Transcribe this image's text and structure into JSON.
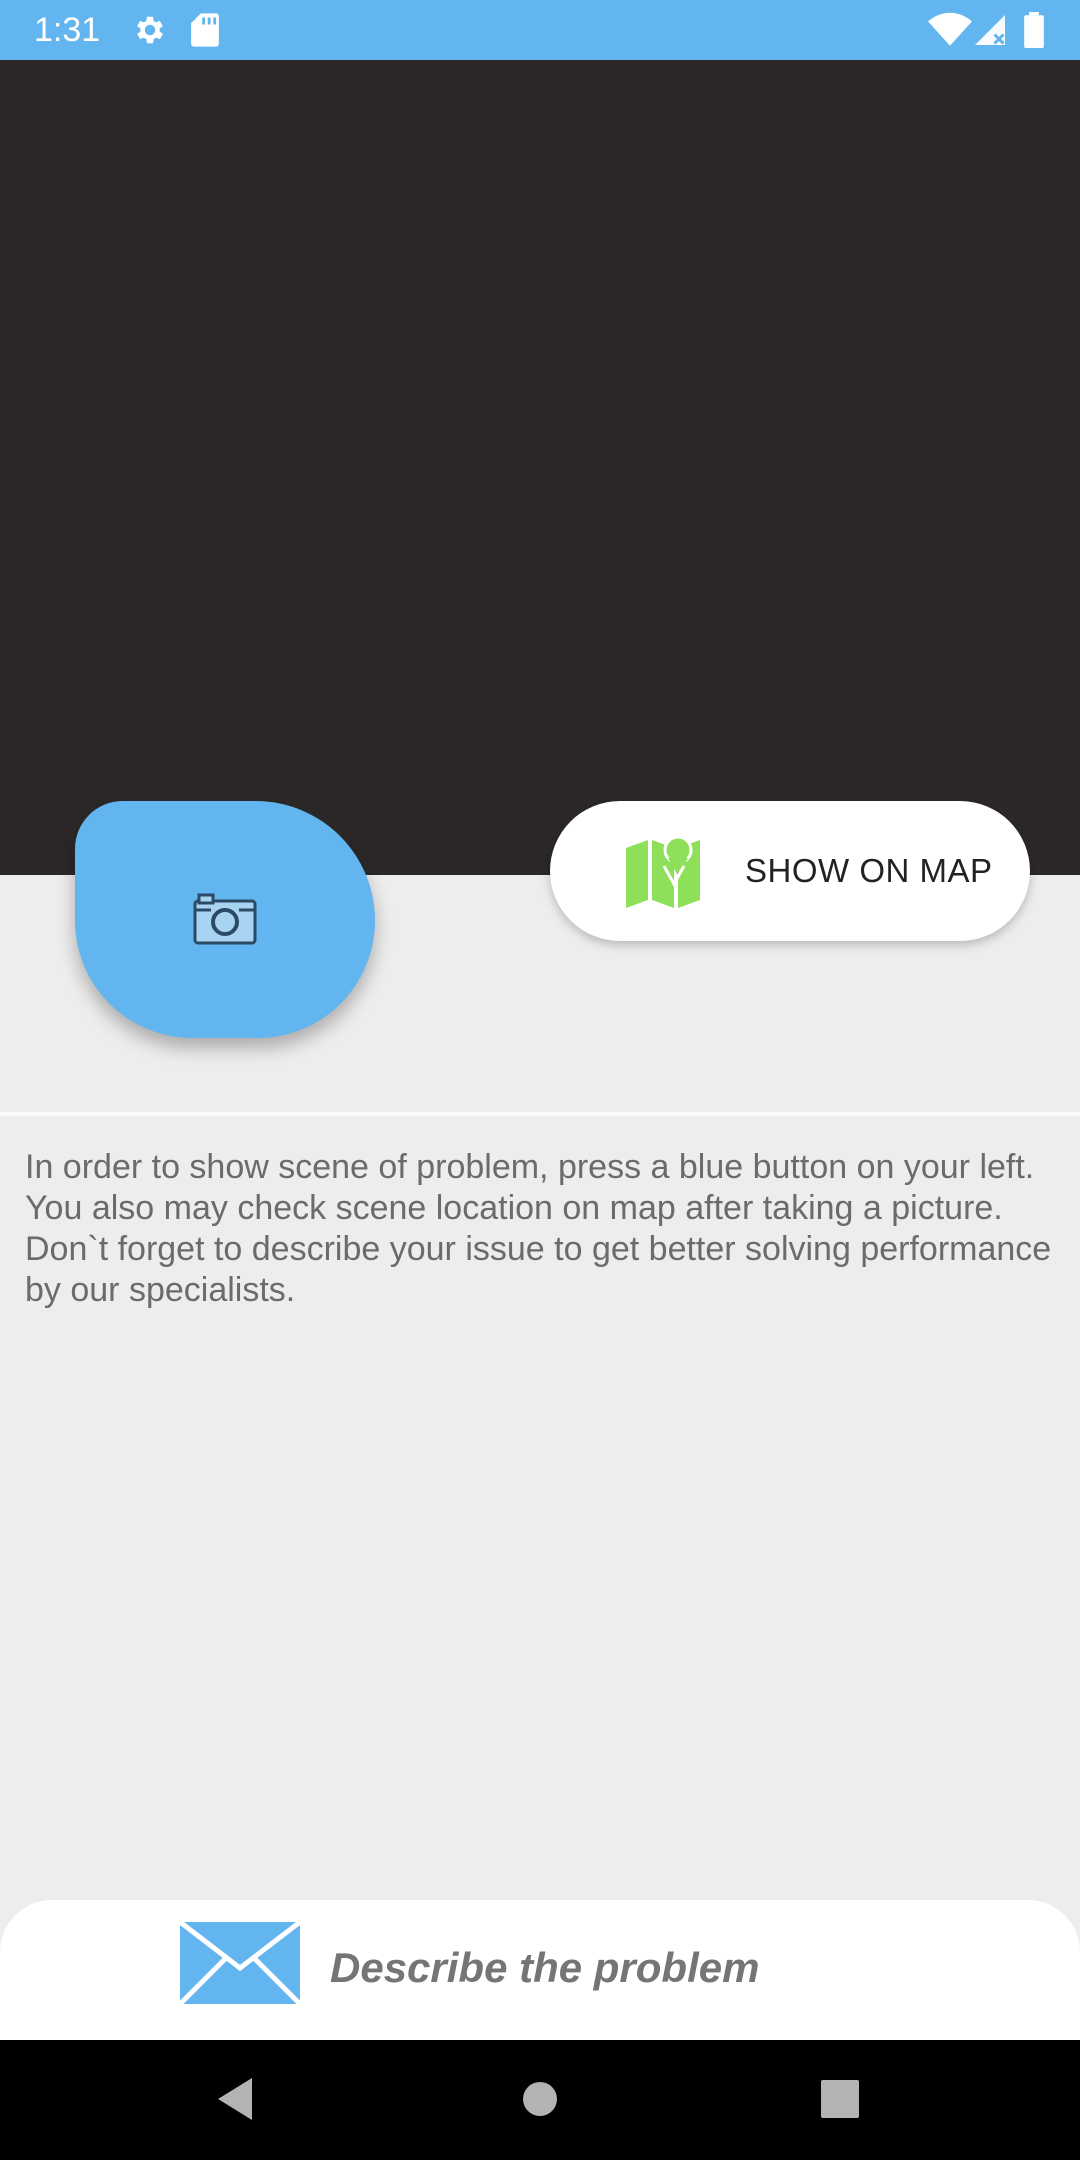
{
  "status_bar": {
    "time": "1:31",
    "left_icons": [
      "gear-icon",
      "sd-card-icon"
    ],
    "right_icons": [
      "wifi-icon",
      "signal-icon",
      "battery-icon"
    ]
  },
  "camera_button": {
    "icon": "camera-icon"
  },
  "map_button": {
    "label": "SHOW ON MAP",
    "icon": "map-icon"
  },
  "instructions": {
    "text": "In order to show scene of problem, press a blue button on your left. You also may check scene location on map after taking a picture.\n Don`t forget to describe your issue to get better solving performance by our specialists."
  },
  "describe_bar": {
    "label": "Describe the problem",
    "icon": "envelope-icon"
  },
  "nav_bar": {
    "buttons": [
      "back-icon",
      "home-icon",
      "recents-icon"
    ]
  },
  "colors": {
    "accent": "#62b5ee",
    "preview_bg": "#2c2828",
    "page_bg": "#ededed",
    "map_green": "#8ee05a"
  }
}
